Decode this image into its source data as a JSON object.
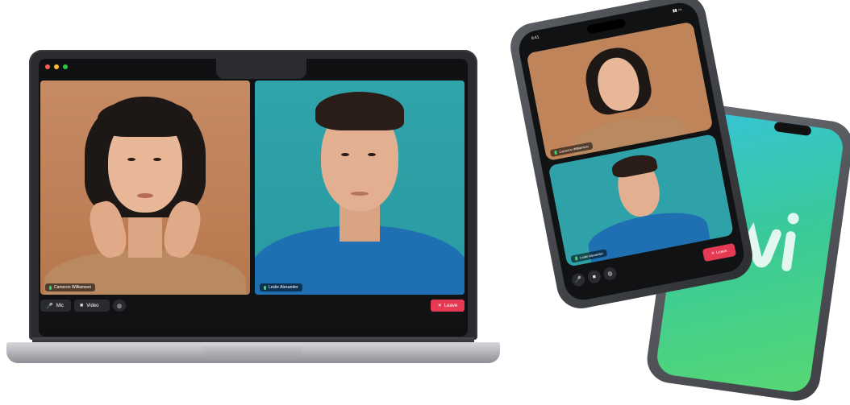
{
  "window": {
    "traffic_lights": [
      "#ff5f57",
      "#febc2e",
      "#28c840"
    ]
  },
  "participants": [
    {
      "name": "Cameron Williamson",
      "bg": "#c0845b",
      "shirt": "#b58762",
      "hair": "#1d1715",
      "skin": "#e7b797"
    },
    {
      "name": "Leslie Alexander",
      "bg": "#2fa2a9",
      "shirt": "#1f6fb3",
      "hair": "#2a1c17",
      "skin": "#e2b090"
    }
  ],
  "controls": {
    "mic_label": "Mic",
    "video_label": "Video",
    "leave_label": "Leave",
    "mic_icon": "microphone-icon",
    "video_icon": "camera-icon",
    "chat_icon": "chat-icon",
    "leave_icon": "close-icon",
    "leave_color": "#e63a54"
  },
  "phone": {
    "status_time": "9:41",
    "participants": [
      "Cameron Williamson",
      "Leslie Alexander"
    ],
    "leave_label": "Leave"
  },
  "brand": {
    "gradient_from": "#35c3d9",
    "gradient_to": "#59d86f"
  }
}
